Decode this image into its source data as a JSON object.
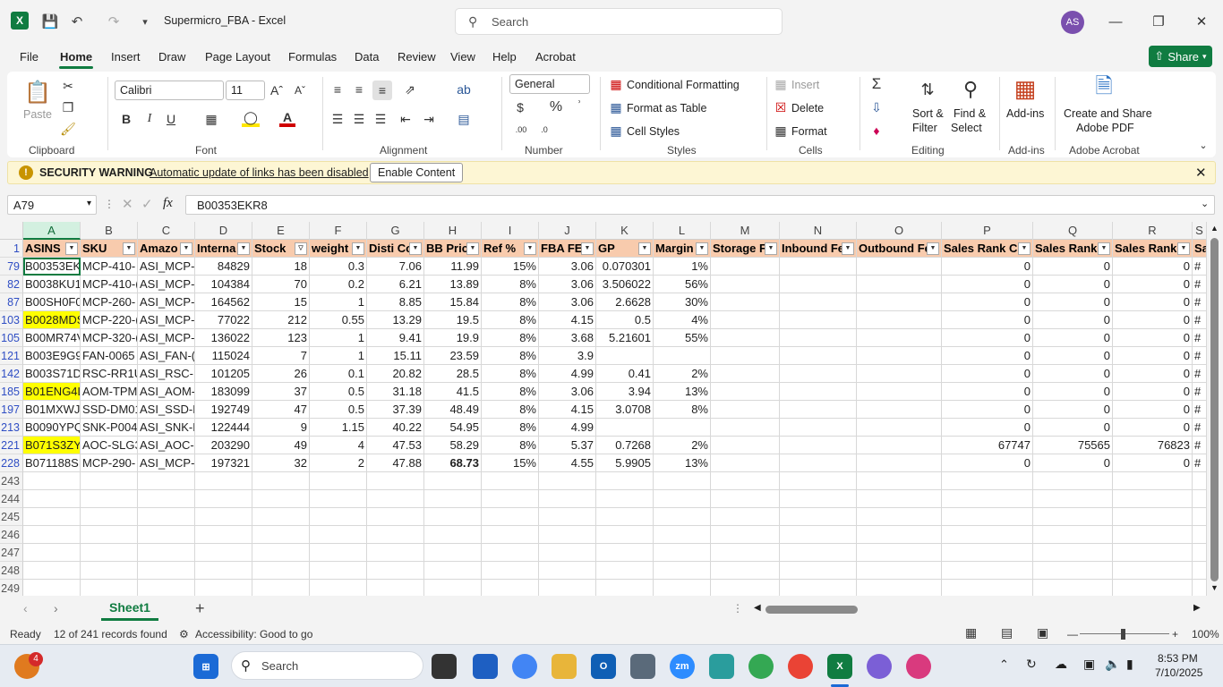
{
  "titlebar": {
    "app_icon": "excel-icon",
    "doc_title": "Supermicro_FBA  -  Excel",
    "search_placeholder": "Search",
    "user_initials": "AS"
  },
  "menu": [
    "File",
    "Home",
    "Insert",
    "Draw",
    "Page Layout",
    "Formulas",
    "Data",
    "Review",
    "View",
    "Help",
    "Acrobat"
  ],
  "share_label": "Share",
  "ribbon": {
    "clipboard": {
      "paste": "Paste",
      "group": "Clipboard"
    },
    "font": {
      "name": "Calibri",
      "size": "11",
      "group": "Font"
    },
    "alignment": {
      "group": "Alignment"
    },
    "number": {
      "format": "General",
      "group": "Number"
    },
    "styles": {
      "cond": "Conditional Formatting",
      "table": "Format as Table",
      "cell": "Cell Styles",
      "group": "Styles"
    },
    "cells": {
      "insert": "Insert",
      "delete": "Delete",
      "format": "Format",
      "group": "Cells"
    },
    "editing": {
      "sort1": "Sort &",
      "sort2": "Filter",
      "find1": "Find &",
      "find2": "Select",
      "group": "Editing"
    },
    "addins": {
      "label": "Add-ins",
      "group": "Add-ins"
    },
    "acrobat": {
      "l1": "Create and Share",
      "l2": "Adobe PDF",
      "group": "Adobe Acrobat"
    }
  },
  "security": {
    "title": "SECURITY WARNING",
    "message": "Automatic update of links has been disabled",
    "button": "Enable Content"
  },
  "formula": {
    "namebox": "A79",
    "fx": "fx",
    "value": "B00353EKR8"
  },
  "columns": [
    "A",
    "B",
    "C",
    "D",
    "E",
    "F",
    "G",
    "H",
    "I",
    "J",
    "K",
    "L",
    "M",
    "N",
    "O",
    "P",
    "Q",
    "R",
    "S"
  ],
  "headers": [
    "ASINS",
    "SKU",
    "Amazo",
    "Interna",
    "Stock",
    "weight",
    "Disti Co",
    "BB Pric",
    "Ref %",
    "FBA FEI",
    "GP",
    "Margin",
    "Storage F",
    "Inbound Fe",
    "Outbound Fe",
    "Sales Rank Cu",
    "Sales Rank",
    "Sales Rank",
    "Sa"
  ],
  "rows": [
    {
      "n": "79",
      "c": [
        "B00353EKR8",
        "MCP-410-",
        "ASI_MCP-",
        "84829",
        "18",
        "0.3",
        "7.06",
        "11.99",
        "15%",
        "3.06",
        "0.070301",
        "1%",
        "",
        "",
        "",
        "0",
        "0",
        "0",
        "#"
      ]
    },
    {
      "n": "82",
      "c": [
        "B0038KU1",
        "MCP-410-(",
        "ASI_MCP-",
        "104384",
        "70",
        "0.2",
        "6.21",
        "13.89",
        "8%",
        "3.06",
        "3.506022",
        "56%",
        "",
        "",
        "",
        "0",
        "0",
        "0",
        "#"
      ]
    },
    {
      "n": "87",
      "c": [
        "B00SH0F0",
        "MCP-260-",
        "ASI_MCP-",
        "164562",
        "15",
        "1",
        "8.85",
        "15.84",
        "8%",
        "3.06",
        "2.6628",
        "30%",
        "",
        "",
        "",
        "0",
        "0",
        "0",
        "#"
      ]
    },
    {
      "n": "103",
      "c": [
        "B0028MDS",
        "MCP-220-(",
        "ASI_MCP-",
        "77022",
        "212",
        "0.55",
        "13.29",
        "19.5",
        "8%",
        "4.15",
        "0.5",
        "4%",
        "",
        "",
        "",
        "0",
        "0",
        "0",
        "#"
      ]
    },
    {
      "n": "105",
      "c": [
        "B00MR74V",
        "MCP-320-(",
        "ASI_MCP-",
        "136022",
        "123",
        "1",
        "9.41",
        "19.9",
        "8%",
        "3.68",
        "5.21601",
        "55%",
        "",
        "",
        "",
        "0",
        "0",
        "0",
        "#"
      ]
    },
    {
      "n": "121",
      "c": [
        "B003E9G9.",
        "FAN-0065",
        "ASI_FAN-(",
        "115024",
        "7",
        "1",
        "15.11",
        "23.59",
        "8%",
        "3.9",
        "",
        "",
        "",
        "",
        "",
        "0",
        "0",
        "0",
        "#"
      ]
    },
    {
      "n": "142",
      "c": [
        "B003S71DI",
        "RSC-RR1U",
        "ASI_RSC-R",
        "101205",
        "26",
        "0.1",
        "20.82",
        "28.5",
        "8%",
        "4.99",
        "0.41",
        "2%",
        "",
        "",
        "",
        "0",
        "0",
        "0",
        "#"
      ]
    },
    {
      "n": "185",
      "c": [
        "B01ENG4L",
        "AOM-TPM",
        "ASI_AOM-",
        "183099",
        "37",
        "0.5",
        "31.18",
        "41.5",
        "8%",
        "3.06",
        "3.94",
        "13%",
        "",
        "",
        "",
        "0",
        "0",
        "0",
        "#"
      ]
    },
    {
      "n": "197",
      "c": [
        "B01MXWJ",
        "SSD-DM01",
        "ASI_SSD-D",
        "192749",
        "47",
        "0.5",
        "37.39",
        "48.49",
        "8%",
        "4.15",
        "3.0708",
        "8%",
        "",
        "",
        "",
        "0",
        "0",
        "0",
        "#"
      ]
    },
    {
      "n": "213",
      "c": [
        "B0090YPQ",
        "SNK-P004",
        "ASI_SNK-F",
        "122444",
        "9",
        "1.15",
        "40.22",
        "54.95",
        "8%",
        "4.99",
        "",
        "",
        "",
        "",
        "",
        "0",
        "0",
        "0",
        "#"
      ]
    },
    {
      "n": "221",
      "c": [
        "B071S3ZY8",
        "AOC-SLG3",
        "ASI_AOC-S",
        "203290",
        "49",
        "4",
        "47.53",
        "58.29",
        "8%",
        "5.37",
        "0.7268",
        "2%",
        "",
        "",
        "",
        "67747",
        "75565",
        "76823",
        "#"
      ]
    },
    {
      "n": "228",
      "c": [
        "B071188SI",
        "MCP-290-",
        "ASI_MCP-",
        "197321",
        "32",
        "2",
        "47.88",
        "68.73",
        "15%",
        "4.55",
        "5.9905",
        "13%",
        "",
        "",
        "",
        "0",
        "0",
        "0",
        "#"
      ]
    }
  ],
  "empty_rows": [
    "243",
    "244",
    "245",
    "246",
    "247",
    "248",
    "249"
  ],
  "highlight_colors": {
    "header": "#f8cbad",
    "yellow": "#ffff00",
    "accent": "#107c41"
  },
  "sheet": {
    "tab": "Sheet1"
  },
  "status": {
    "ready": "Ready",
    "records": "12 of 241 records found",
    "access": "Accessibility: Good to go",
    "zoom": "100%"
  },
  "taskbar": {
    "search": "Search",
    "time": "8:53 PM",
    "date": "7/10/2025",
    "badge": "4"
  }
}
